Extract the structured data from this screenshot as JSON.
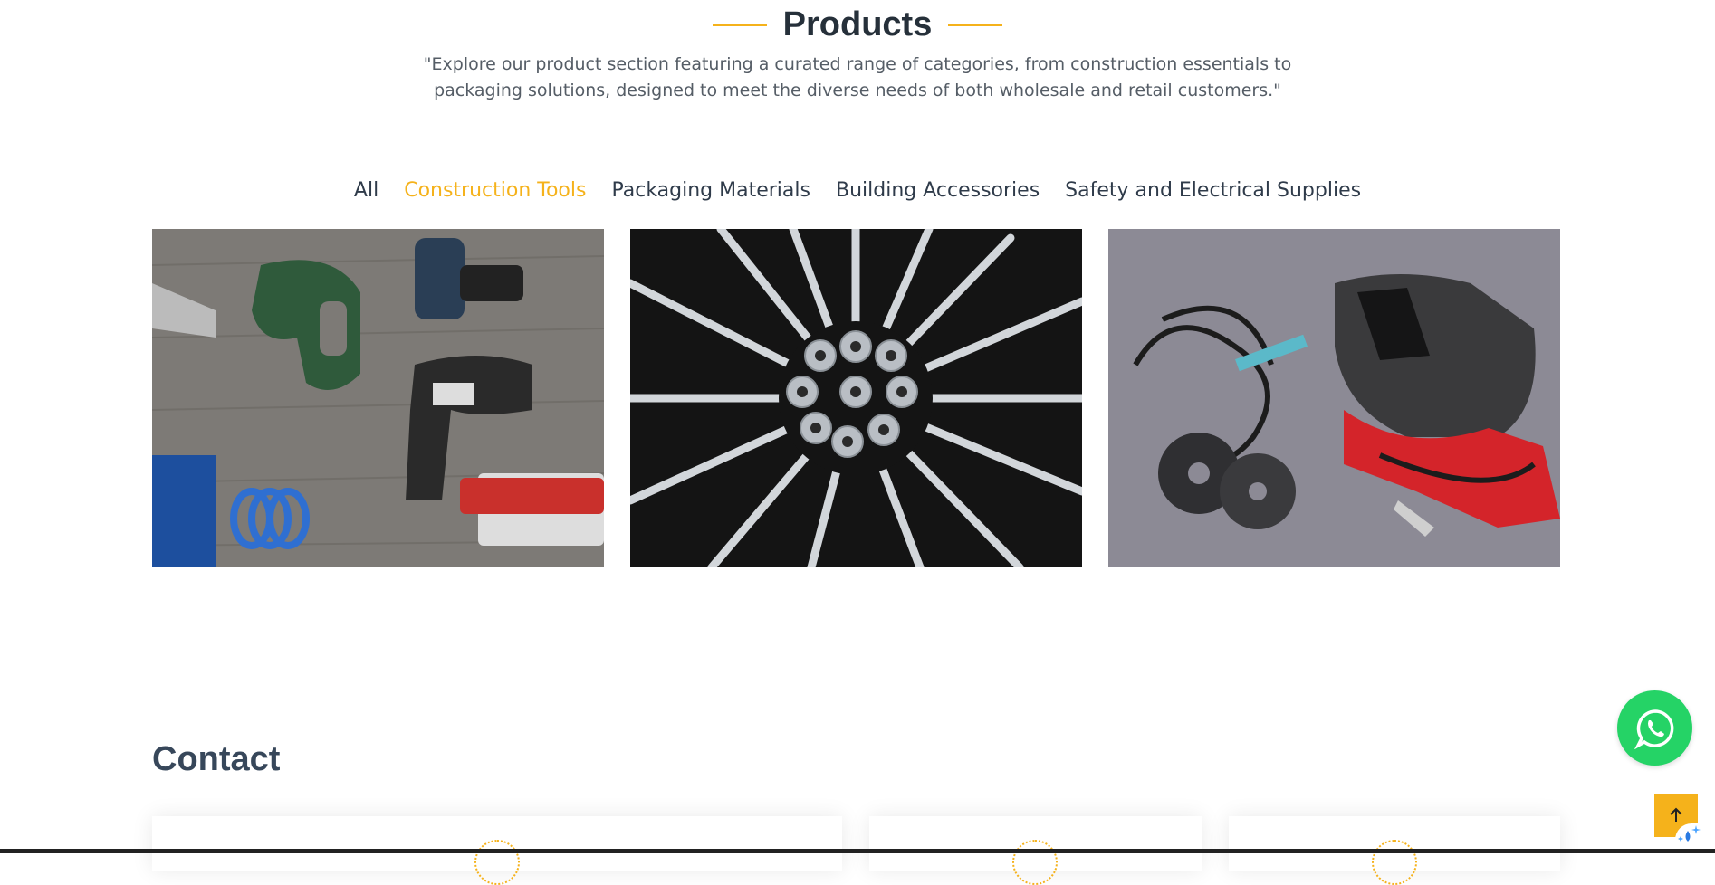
{
  "products": {
    "title": "Products",
    "description": "\"Explore our product section featuring a curated range of categories, from construction essentials to packaging solutions, designed to meet the diverse needs of both wholesale and retail customers.\""
  },
  "filters": [
    {
      "label": "All",
      "active": false
    },
    {
      "label": "Construction Tools",
      "active": true
    },
    {
      "label": "Packaging Materials",
      "active": false
    },
    {
      "label": "Building Accessories",
      "active": false
    },
    {
      "label": "Safety and Electrical Supplies",
      "active": false
    }
  ],
  "gallery": [
    {
      "image": "power-tools-photo"
    },
    {
      "image": "screws-and-washers-photo"
    },
    {
      "image": "welding-equipment-photo"
    }
  ],
  "contact": {
    "title": "Contact"
  },
  "floating": {
    "whatsapp_icon": "whatsapp-icon",
    "back_to_top_icon": "arrow-up-icon"
  },
  "colors": {
    "accent": "#f5b21b",
    "heading": "#26303a",
    "whatsapp": "#25d366"
  }
}
